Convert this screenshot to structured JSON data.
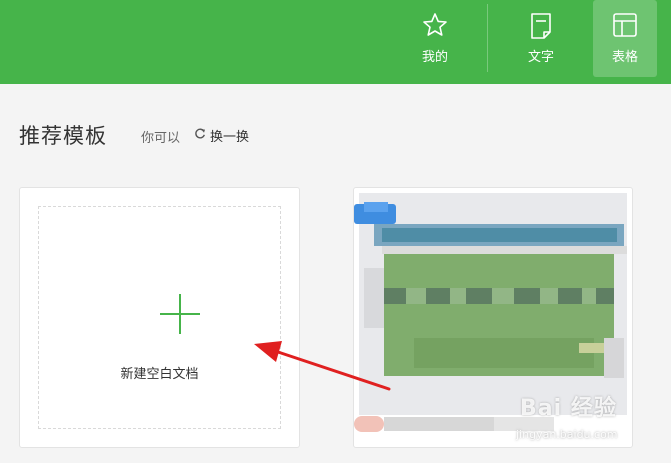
{
  "header": {
    "tabs": [
      {
        "label": "我的",
        "icon": "star-icon",
        "active": false
      },
      {
        "label": "文字",
        "icon": "document-icon",
        "active": false
      },
      {
        "label": "表格",
        "icon": "table-icon",
        "active": true
      }
    ]
  },
  "section": {
    "title": "推荐模板",
    "hint": "你可以",
    "refresh_label": "换一换"
  },
  "new_doc": {
    "label": "新建空白文档"
  },
  "watermark": {
    "logo": "Bai 经验",
    "url": "jingyan.baidu.com"
  },
  "colors": {
    "brand_green": "#46b44a",
    "annotation_arrow": "#e02020"
  }
}
